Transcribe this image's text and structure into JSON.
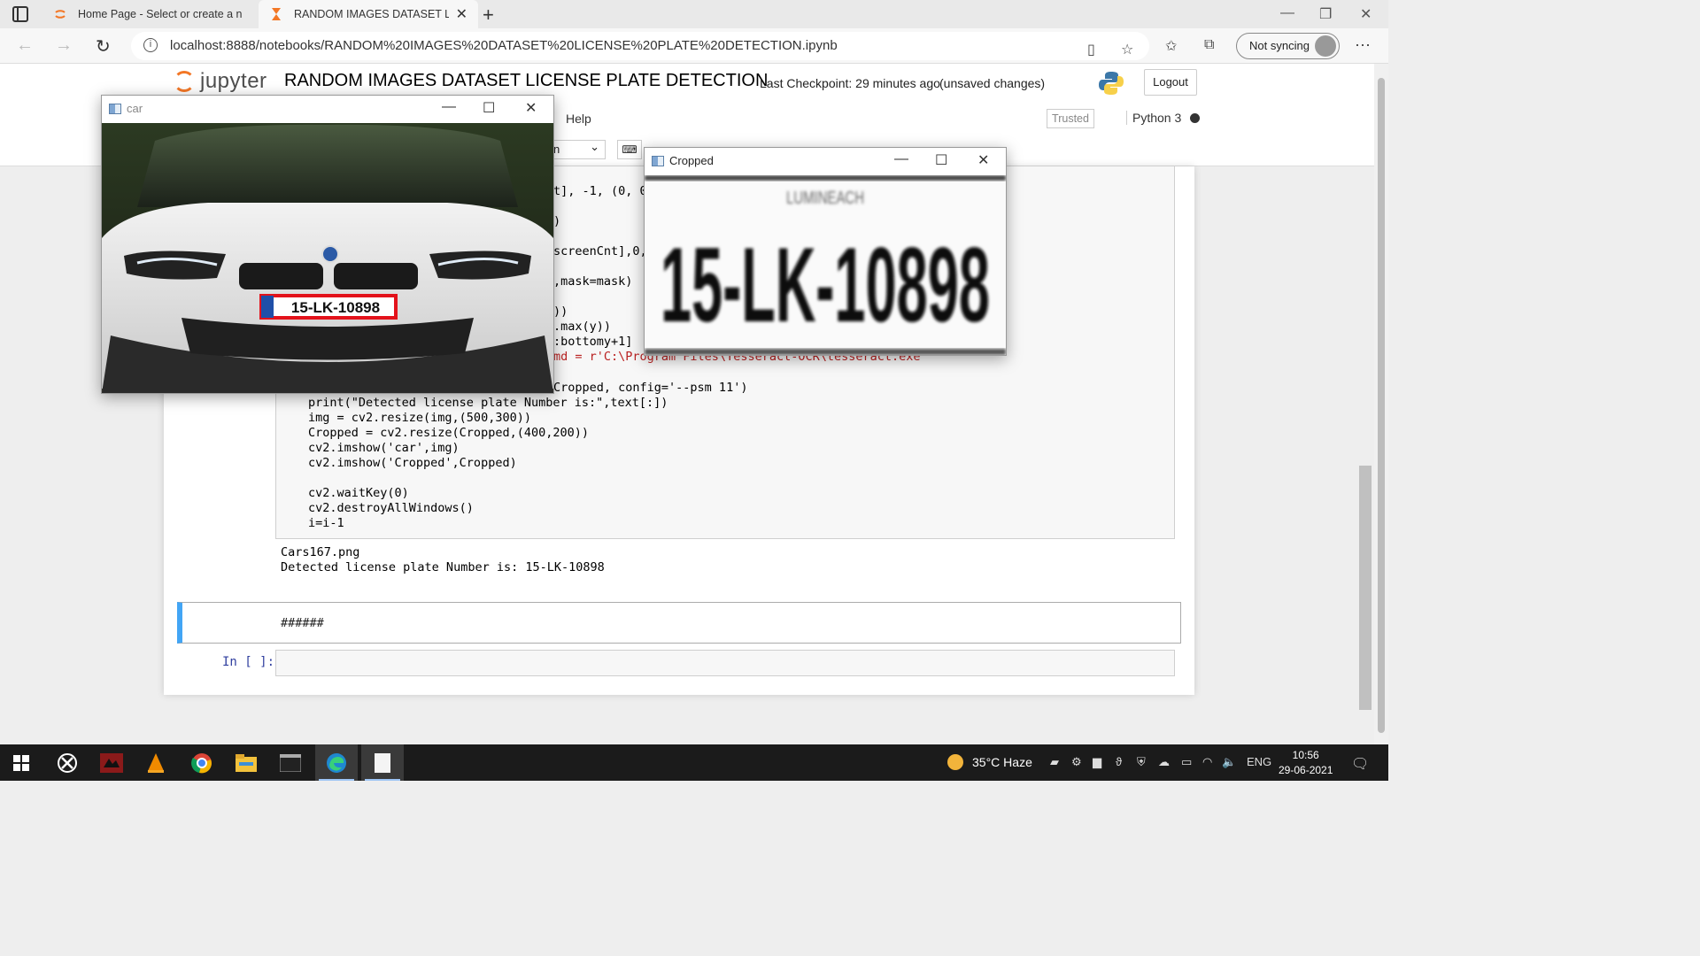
{
  "browser": {
    "tabs": [
      {
        "label": "Home Page - Select or create a n",
        "icon": "jupyter-icon"
      },
      {
        "label": "RANDOM IMAGES DATASET LICE",
        "icon": "hourglass-icon"
      }
    ],
    "url": "localhost:8888/notebooks/RANDOM%20IMAGES%20DATASET%20LICENSE%20PLATE%20DETECTION.ipynb",
    "sync_label": "Not syncing"
  },
  "jupyter": {
    "logo_text": "jupyter",
    "notebook_title": "RANDOM IMAGES DATASET LICENSE PLATE DETECTION",
    "checkpoint": "Last Checkpoint: 29 minutes ago",
    "unsaved": "(unsaved changes)",
    "logout_label": "Logout",
    "menu_help": "Help",
    "trusted": "Trusted",
    "kernel": "Python 3",
    "celltype_value": "n"
  },
  "code": {
    "fragments": [
      "t], -1, (0, 0",
      ")",
      "screenCnt],0,",
      ",mask=mask)",
      "))",
      ".max(y))",
      ":bottomy+1]",
      "md = r'C:\\Program Files\\Tesseract-OCR\\tesseract.exe",
      "Cropped, config='--psm 11')"
    ],
    "lines": [
      "print(\"Detected license plate Number is:\",text[:])",
      "img = cv2.resize(img,(500,300))",
      "Cropped = cv2.resize(Cropped,(400,200))",
      "cv2.imshow('car',img)",
      "cv2.imshow('Cropped',Cropped)",
      "",
      "cv2.waitKey(0)",
      "cv2.destroyAllWindows()",
      "i=i-1"
    ]
  },
  "output": {
    "filename": "Cars167.png",
    "result": "Detected license plate Number is: 15-LK-10898"
  },
  "markdown_cell": "######",
  "empty_prompt": "In [ ]:",
  "windows": {
    "car": {
      "title": "car",
      "plate": "15-LK-10898"
    },
    "cropped": {
      "title": "Cropped",
      "plate": "15-LK-10898",
      "top_text": "LUMINEACH"
    }
  },
  "taskbar": {
    "weather": "35°C  Haze",
    "lang": "ENG",
    "time": "10:56",
    "date": "29-06-2021"
  }
}
